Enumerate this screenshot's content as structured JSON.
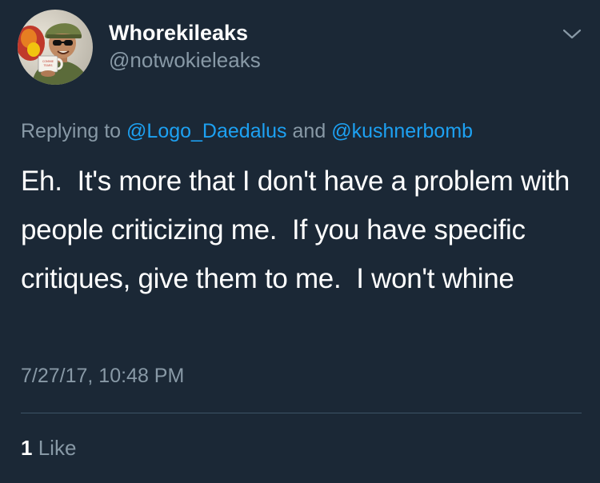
{
  "tweet": {
    "author": {
      "display_name": "Whorekileaks",
      "handle": "@notwokieleaks",
      "avatar_mug_text": "COMMIE TEARS"
    },
    "reply_context": {
      "prefix": "Replying to",
      "mention_1": "@Logo_Daedalus",
      "conjunction": "and",
      "mention_2": "@kushnerbomb"
    },
    "text": "Eh.  It's more that I don't have a problem with people criticizing me.  If you have specific critiques, give them to me.  I won't whine",
    "timestamp": "7/27/17, 10:48 PM",
    "likes": {
      "count": "1",
      "label": "Like"
    },
    "icons": {
      "menu": "chevron-down-icon"
    },
    "colors": {
      "background": "#1b2836",
      "secondary_text": "#8899a6",
      "link": "#1da1f2",
      "divider": "#3d5466"
    }
  }
}
